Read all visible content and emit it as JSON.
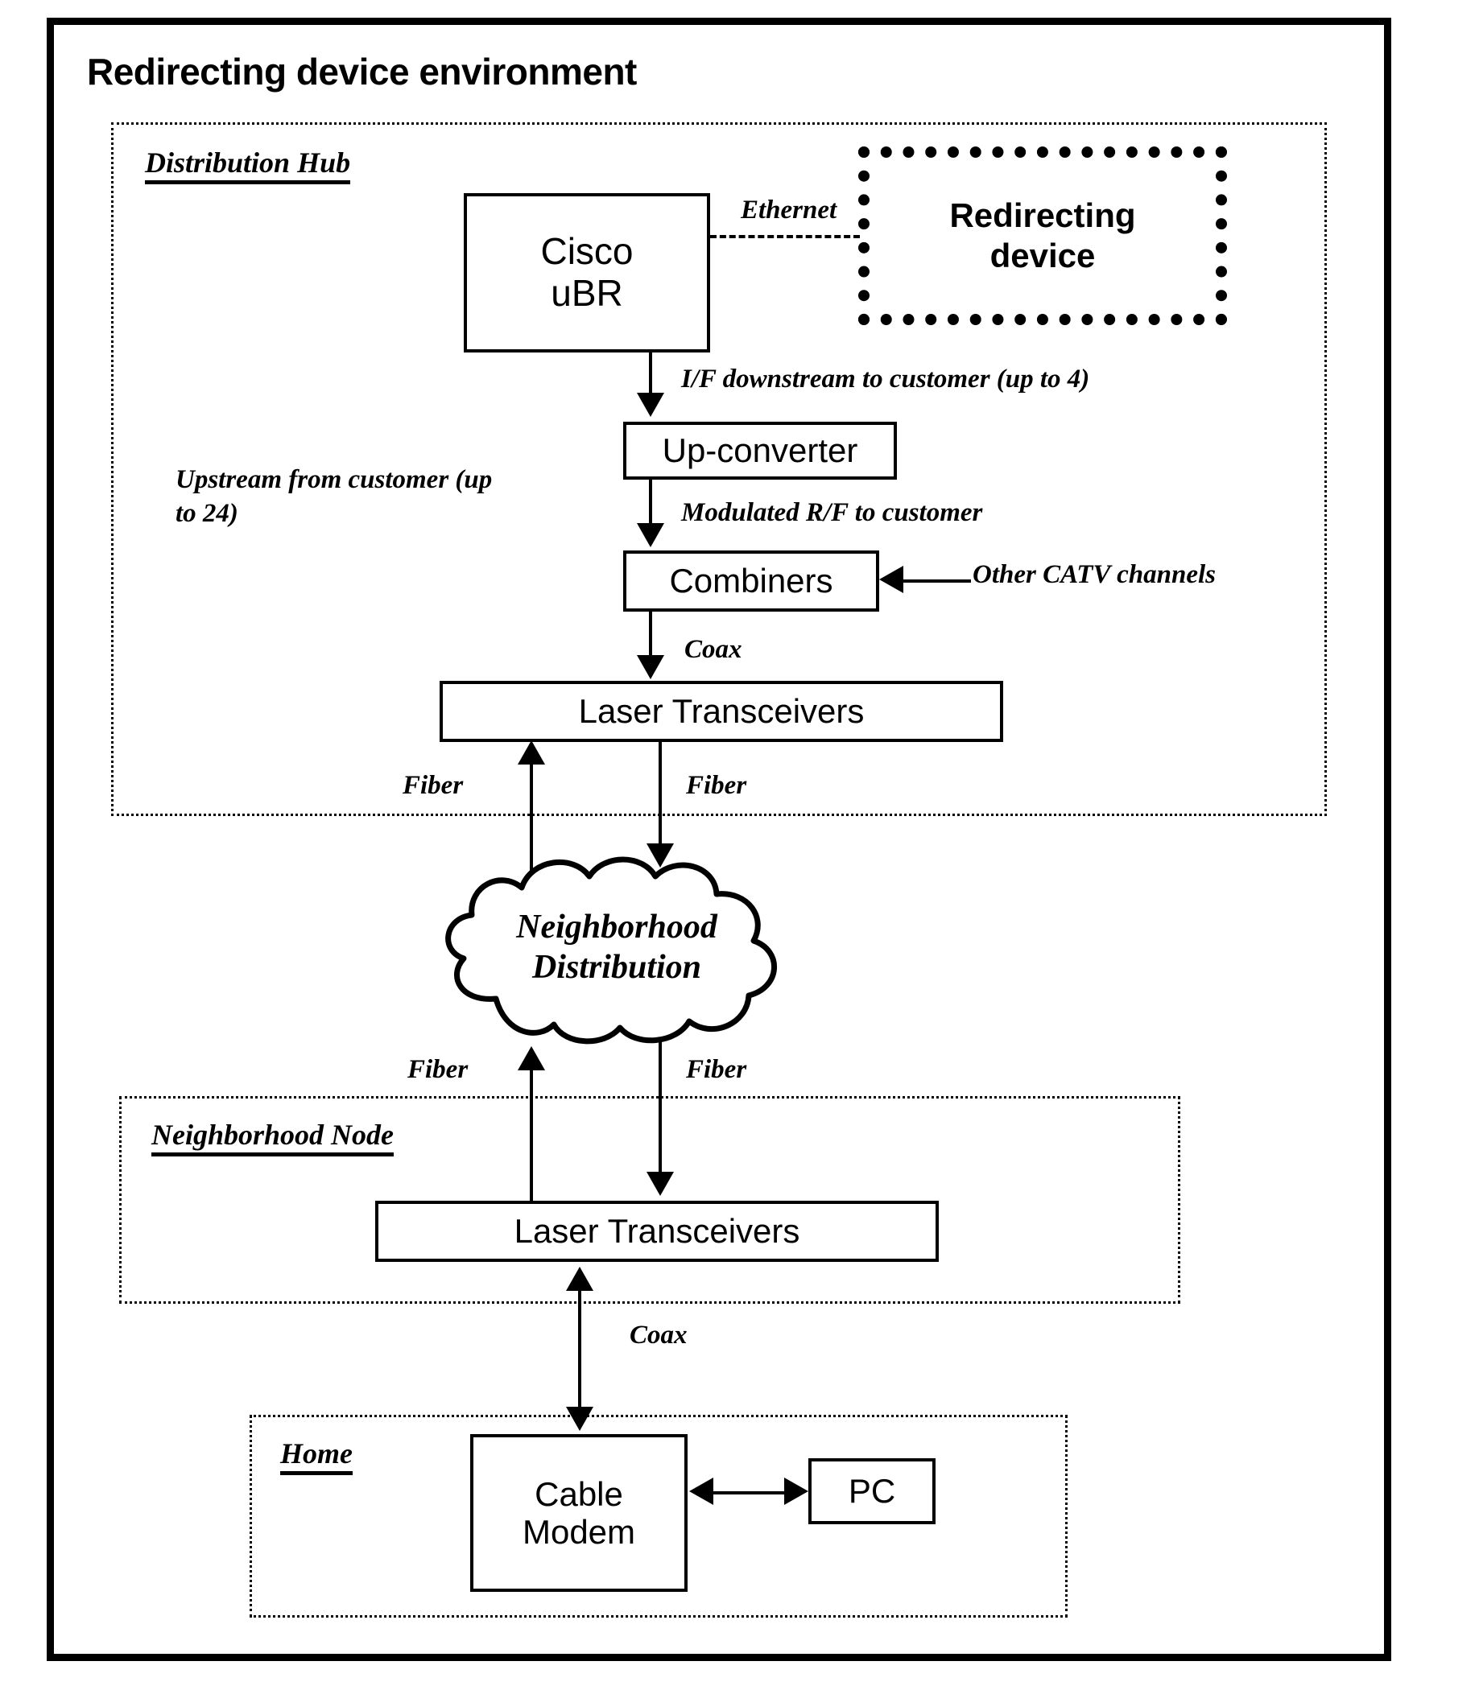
{
  "figure": {
    "title": "Redirecting device environment"
  },
  "zones": {
    "distribution_hub": {
      "label": "Distribution Hub"
    },
    "neighborhood_node": {
      "label": "Neighborhood Node"
    },
    "home": {
      "label": "Home"
    }
  },
  "nodes": {
    "redirecting_device": {
      "line1": "Redirecting",
      "line2": "device"
    },
    "cisco_ubr": {
      "line1": "Cisco",
      "line2": "uBR"
    },
    "up_converter": {
      "label": "Up-converter"
    },
    "combiners": {
      "label": "Combiners"
    },
    "laser_transceivers_hub": {
      "label": "Laser Transceivers"
    },
    "laser_transceivers_node": {
      "label": "Laser Transceivers"
    },
    "cloud": {
      "line1": "Neighborhood",
      "line2": "Distribution"
    },
    "cable_modem": {
      "line1": "Cable",
      "line2": "Modem"
    },
    "pc": {
      "label": "PC"
    }
  },
  "edge_labels": {
    "ethernet": "Ethernet",
    "if_downstream": "I/F downstream to customer (up to 4)",
    "upstream": "Upstream from customer (up to 24)",
    "modulated_rf": "Modulated R/F to customer",
    "other_catv": "Other CATV channels",
    "coax_hub": "Coax",
    "fiber_hub_left": "Fiber",
    "fiber_hub_right": "Fiber",
    "fiber_node_left": "Fiber",
    "fiber_node_right": "Fiber",
    "coax_home": "Coax"
  },
  "colors": {
    "ink": "#000000",
    "paper": "#ffffff"
  }
}
